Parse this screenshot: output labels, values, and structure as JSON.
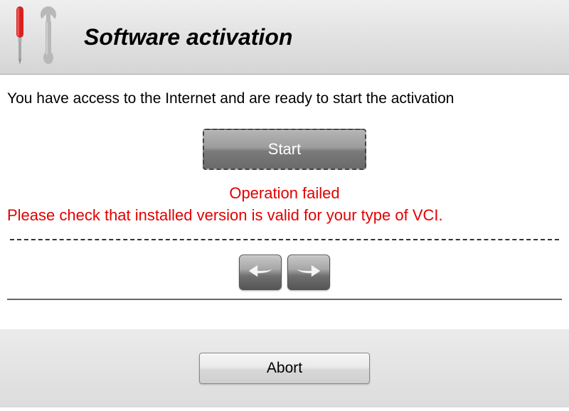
{
  "header": {
    "title": "Software activation"
  },
  "main": {
    "instruction": "You have access to the Internet and are ready to start the activation",
    "start_label": "Start",
    "error_line1": "Operation failed",
    "error_line2": "Please check that installed version is valid for your type of VCI."
  },
  "footer": {
    "abort_label": "Abort"
  },
  "icons": {
    "screwdriver": "screwdriver-icon",
    "wrench": "wrench-icon",
    "arrow_left": "arrow-left-icon",
    "arrow_right": "arrow-right-icon"
  }
}
